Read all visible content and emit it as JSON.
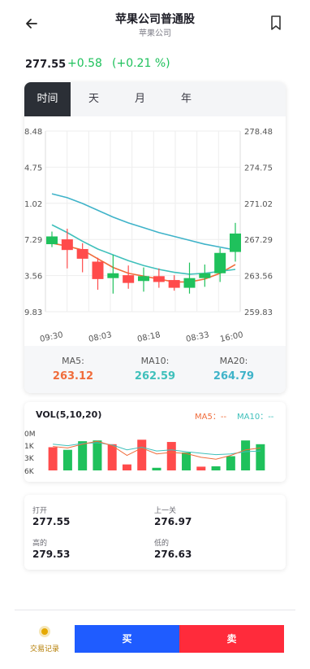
{
  "header": {
    "title": "苹果公司普通股",
    "subtitle": "苹果公司",
    "back_icon": "arrow-left-icon",
    "bookmark_icon": "bookmark-icon"
  },
  "quote": {
    "price": "277.55",
    "change": "+0.58",
    "change_pct": "(+0.21 %)",
    "up_color": "#1fc15c",
    "down_color": "#ff4b4b"
  },
  "tabs": [
    {
      "label": "时间",
      "active": true
    },
    {
      "label": "天",
      "active": false
    },
    {
      "label": "月",
      "active": false
    },
    {
      "label": "年",
      "active": false
    }
  ],
  "chart_data": [
    {
      "type": "candlestick",
      "left_ticks": [
        "8.48",
        "4.75",
        "1.02",
        "7.29",
        "3.56",
        "9.83"
      ],
      "right_ticks": [
        "278.48",
        "274.75",
        "271.02",
        "267.29",
        "263.56",
        "259.83"
      ],
      "ylim": [
        259.83,
        278.48
      ],
      "x_ticks": [
        "09:30",
        "08:03",
        "08:18",
        "08:33",
        "16:00"
      ],
      "candles": [
        {
          "open": 266.8,
          "close": 267.6,
          "high": 268.1,
          "low": 266.5
        },
        {
          "open": 267.3,
          "close": 266.2,
          "high": 268.4,
          "low": 264.3
        },
        {
          "open": 266.3,
          "close": 265.3,
          "high": 266.9,
          "low": 263.9
        },
        {
          "open": 265.0,
          "close": 263.2,
          "high": 265.4,
          "low": 262.1
        },
        {
          "open": 263.3,
          "close": 263.8,
          "high": 265.7,
          "low": 261.7
        },
        {
          "open": 263.6,
          "close": 262.8,
          "high": 264.6,
          "low": 262.2
        },
        {
          "open": 263.0,
          "close": 263.5,
          "high": 264.4,
          "low": 261.9
        },
        {
          "open": 263.5,
          "close": 262.9,
          "high": 264.3,
          "low": 262.3
        },
        {
          "open": 263.1,
          "close": 262.3,
          "high": 263.6,
          "low": 262.0
        },
        {
          "open": 262.3,
          "close": 263.3,
          "high": 264.9,
          "low": 261.7
        },
        {
          "open": 263.3,
          "close": 263.8,
          "high": 264.7,
          "low": 262.4
        },
        {
          "open": 263.8,
          "close": 265.9,
          "high": 266.4,
          "low": 262.9
        },
        {
          "open": 266.0,
          "close": 267.9,
          "high": 269.0,
          "low": 265.0
        }
      ],
      "ma_lines": [
        {
          "name": "MA5",
          "color": "#f06c3b",
          "values": [
            266.9,
            266.6,
            266.2,
            265.3,
            264.4,
            263.8,
            263.5,
            263.2,
            262.9,
            262.9,
            263.2,
            263.8,
            264.7
          ]
        },
        {
          "name": "MA10",
          "color": "#3fc0bb",
          "values": [
            268.8,
            268.0,
            267.1,
            266.3,
            265.7,
            265.1,
            264.6,
            264.2,
            263.9,
            263.7,
            263.8,
            264.0,
            264.2
          ]
        },
        {
          "name": "MA20",
          "color": "#3fb3c9",
          "values": [
            272.0,
            271.6,
            271.0,
            270.3,
            269.6,
            269.0,
            268.5,
            268.0,
            267.6,
            267.2,
            266.8,
            266.5,
            266.2
          ]
        }
      ]
    },
    {
      "type": "bar",
      "title": "VOL(5,10,20)",
      "ticks": [
        "0M",
        "1K",
        "3K",
        "6K"
      ],
      "values": [
        0.62,
        0.55,
        0.78,
        0.8,
        0.7,
        0.16,
        0.82,
        0.07,
        0.76,
        0.48,
        0.1,
        0.11,
        0.38,
        0.8,
        0.7
      ],
      "colors": [
        "#ff4b4b",
        "#1fc15c",
        "#1fc15c",
        "#1fc15c",
        "#ff4b4b",
        "#ff4b4b",
        "#ff4b4b",
        "#1fc15c",
        "#ff4b4b",
        "#1fc15c",
        "#ff4b4b",
        "#1fc15c",
        "#1fc15c",
        "#1fc15c",
        "#1fc15c"
      ],
      "ma5": [
        0.64,
        0.6,
        0.7,
        0.78,
        0.66,
        0.4,
        0.6,
        0.44,
        0.48,
        0.45,
        0.35,
        0.3,
        0.4,
        0.55,
        0.6
      ],
      "ma10": [
        0.7,
        0.66,
        0.72,
        0.74,
        0.68,
        0.55,
        0.62,
        0.52,
        0.55,
        0.5,
        0.46,
        0.42,
        0.44,
        0.5,
        0.52
      ]
    }
  ],
  "ma_summary": [
    {
      "label": "MA5:",
      "value": "263.12",
      "color": "#f06c3b"
    },
    {
      "label": "MA10:",
      "value": "262.59",
      "color": "#3fc0bb"
    },
    {
      "label": "MA20:",
      "value": "264.79",
      "color": "#3fb3c9"
    }
  ],
  "volume": {
    "title": "VOL(5,10,20)",
    "ma5_label": "MA5：--",
    "ma10_label": "MA10：--"
  },
  "stats": {
    "open_label": "打开",
    "open_value": "277.55",
    "prev_label": "上一关",
    "prev_value": "276.97",
    "high_label": "高的",
    "high_value": "279.53",
    "low_label": "低的",
    "low_value": "276.63"
  },
  "bottom": {
    "records_label": "交易记录",
    "records_icon": "coin-icon",
    "buy_label": "买",
    "sell_label": "卖"
  }
}
